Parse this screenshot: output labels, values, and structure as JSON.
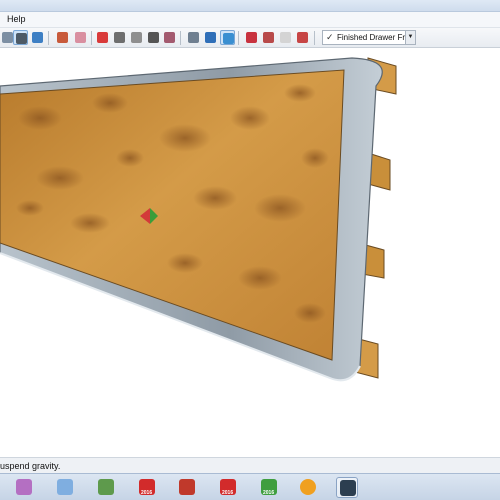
{
  "menubar": {
    "help_label": "Help"
  },
  "toolbar": {
    "scene_check": "✓",
    "scene_tab_label": "Finished Drawer Fro",
    "scene_dropdown_glyph": "▼"
  },
  "statusbar": {
    "text": "uspend gravity."
  },
  "taskbar": {
    "year_label": "2016"
  },
  "colors": {
    "wood": "#c98f3a",
    "frame": "#9aa6b1",
    "accent": "#cfe3f7"
  }
}
